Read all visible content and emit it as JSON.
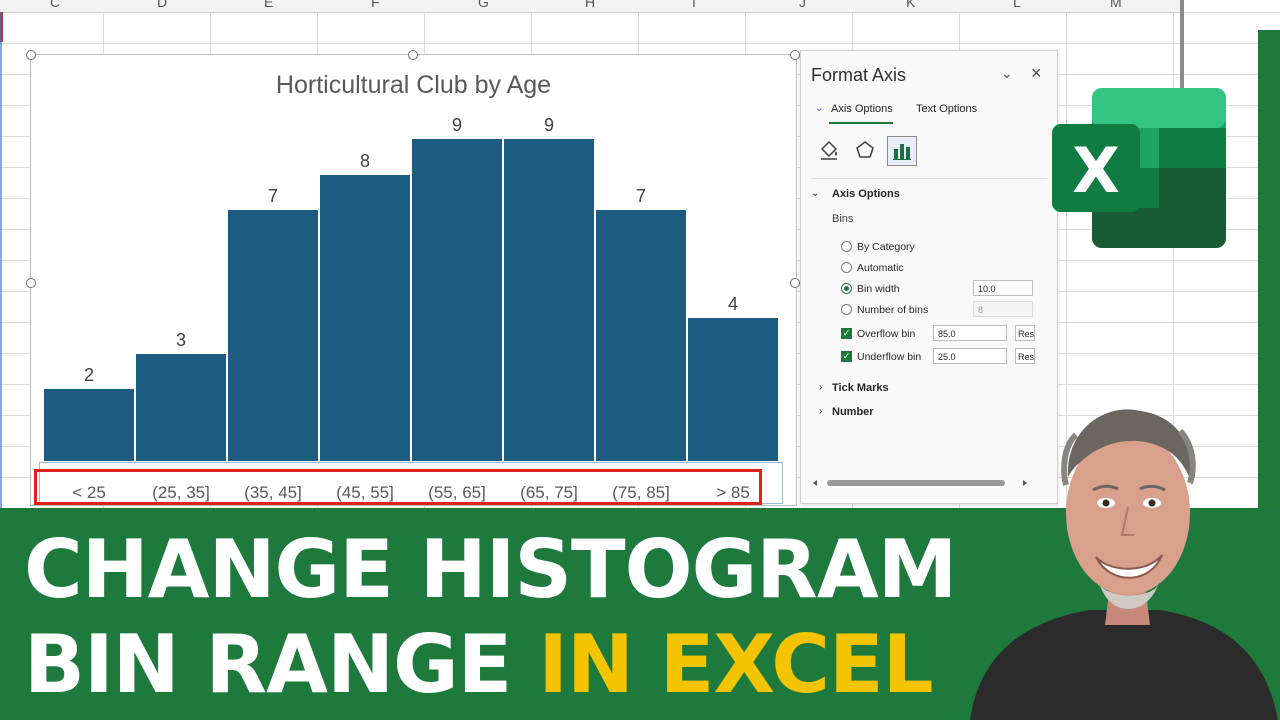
{
  "spreadsheet": {
    "column_headers": [
      "C",
      "D",
      "E",
      "F",
      "G",
      "H",
      "I",
      "J",
      "K",
      "L",
      "M"
    ]
  },
  "chart": {
    "title": "Horticultural Club by Age"
  },
  "chart_data": {
    "type": "bar",
    "title": "Horticultural Club by Age",
    "categories": [
      "< 25",
      "(25, 35]",
      "(35, 45]",
      "(45, 55]",
      "(55, 65]",
      "(65, 75]",
      "(75, 85]",
      "> 85"
    ],
    "values": [
      2,
      3,
      7,
      8,
      9,
      9,
      7,
      4
    ],
    "ylim": [
      0,
      10
    ],
    "grid": false,
    "legend": false,
    "bar_color": "#1b5c80"
  },
  "format_pane": {
    "title": "Format Axis",
    "tabs": {
      "axis_options": "Axis Options",
      "text_options": "Text Options"
    },
    "icons": [
      "paint-bucket-icon",
      "pentagon-icon",
      "bar-chart-icon"
    ],
    "section_axis_options": "Axis Options",
    "bins_label": "Bins",
    "options": {
      "by_category": "By Category",
      "automatic": "Automatic",
      "bin_width": "Bin width",
      "number_of_bins": "Number of bins",
      "overflow_bin": "Overflow bin",
      "underflow_bin": "Underflow bin"
    },
    "selected_option": "Bin width",
    "values": {
      "bin_width": "10.0",
      "number_of_bins": "8",
      "overflow_bin": "85.0",
      "underflow_bin": "25.0"
    },
    "overflow_checked": true,
    "underflow_checked": true,
    "reset_label": "Res",
    "section_tick_marks": "Tick Marks",
    "section_number": "Number"
  },
  "banner": {
    "line1": "CHANGE HISTOGRAM",
    "line2_white": "BIN RANGE",
    "line2_yellow": "IN EXCEL",
    "background": "#1e7a3c",
    "highlight_color": "#f5c400"
  },
  "logo": {
    "letter": "X"
  },
  "colors": {
    "excel_green": "#1f7a3a",
    "selection_red": "#e0201b"
  }
}
